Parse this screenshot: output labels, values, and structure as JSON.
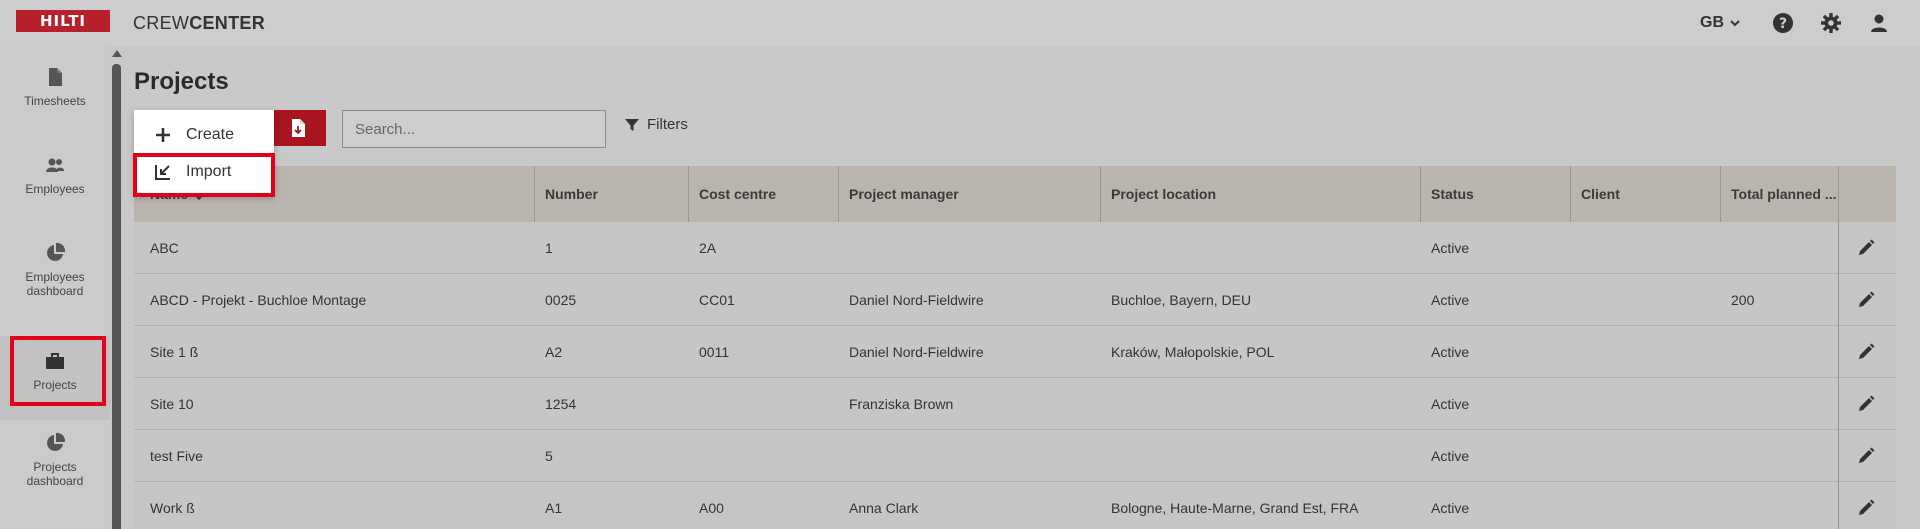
{
  "header": {
    "logo_text": "HILTI",
    "app_name_light": "CREW",
    "app_name_bold": "CENTER",
    "language": "GB",
    "icons": [
      "help-icon",
      "gear-icon",
      "user-icon"
    ]
  },
  "sidebar": {
    "items": [
      {
        "label": "Timesheets",
        "icon": "document-icon"
      },
      {
        "label": "Employees",
        "icon": "people-icon"
      },
      {
        "label": "Employees dashboard",
        "icon": "pie-chart-icon"
      },
      {
        "label": "Projects",
        "icon": "briefcase-icon"
      },
      {
        "label": "Projects dashboard",
        "icon": "pie-chart-icon"
      }
    ]
  },
  "main": {
    "title": "Projects",
    "search_placeholder": "Search...",
    "filters_label": "Filters",
    "menu": {
      "create_label": "Create",
      "import_label": "Import"
    }
  },
  "table": {
    "columns": [
      "Name",
      "Number",
      "Cost centre",
      "Project manager",
      "Project location",
      "Status",
      "Client",
      "Total planned ..."
    ],
    "rows": [
      [
        "ABC",
        "1",
        "2A",
        "",
        "",
        "Active",
        "",
        ""
      ],
      [
        "ABCD - Projekt - Buchloe Montage",
        "0025",
        "CC01",
        "Daniel Nord-Fieldwire",
        "Buchloe, Bayern, DEU",
        "Active",
        "",
        "200"
      ],
      [
        "Site 1 ß",
        "A2",
        "0011",
        "Daniel Nord-Fieldwire",
        "Kraków, Małopolskie, POL",
        "Active",
        "",
        ""
      ],
      [
        "Site 10",
        "1254",
        "",
        "Franziska Brown",
        "",
        "Active",
        "",
        ""
      ],
      [
        "test Five",
        "5",
        "",
        "",
        "",
        "Active",
        "",
        ""
      ],
      [
        "Work ß",
        "A1",
        "A00",
        "Anna Clark",
        "Bologne, Haute-Marne, Grand Est, FRA",
        "Active",
        "",
        ""
      ]
    ]
  },
  "colors": {
    "brand_red": "#b8202b",
    "highlight_red": "#e3001b"
  }
}
